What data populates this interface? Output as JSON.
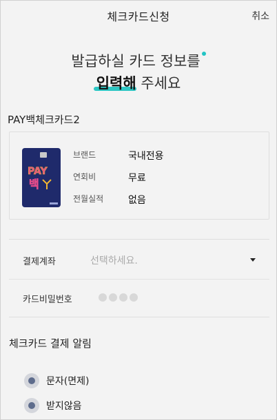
{
  "header": {
    "title": "체크카드신청",
    "cancel_label": "취소"
  },
  "headline": {
    "line1": "발급하실 카드 정보를",
    "line2_emphasis": "입력해",
    "line2_rest": " 주세요"
  },
  "card": {
    "name": "PAY백체크카드2",
    "image_text": "PAY 백",
    "details": [
      {
        "label": "브랜드",
        "value": "국내전용"
      },
      {
        "label": "연회비",
        "value": "무료"
      },
      {
        "label": "전월실적",
        "value": "없음"
      }
    ]
  },
  "form": {
    "account_label": "결제계좌",
    "account_placeholder": "선택하세요.",
    "pin_label": "카드비밀번호",
    "pin_length": 4
  },
  "alert": {
    "title": "체크카드 결제 알림",
    "options": [
      {
        "label": "문자(면제)"
      },
      {
        "label": "받지않음"
      }
    ]
  },
  "colors": {
    "accent": "#2ec7c4",
    "card_bg": "#1f2a6b",
    "radio": "#5e6c8c"
  }
}
